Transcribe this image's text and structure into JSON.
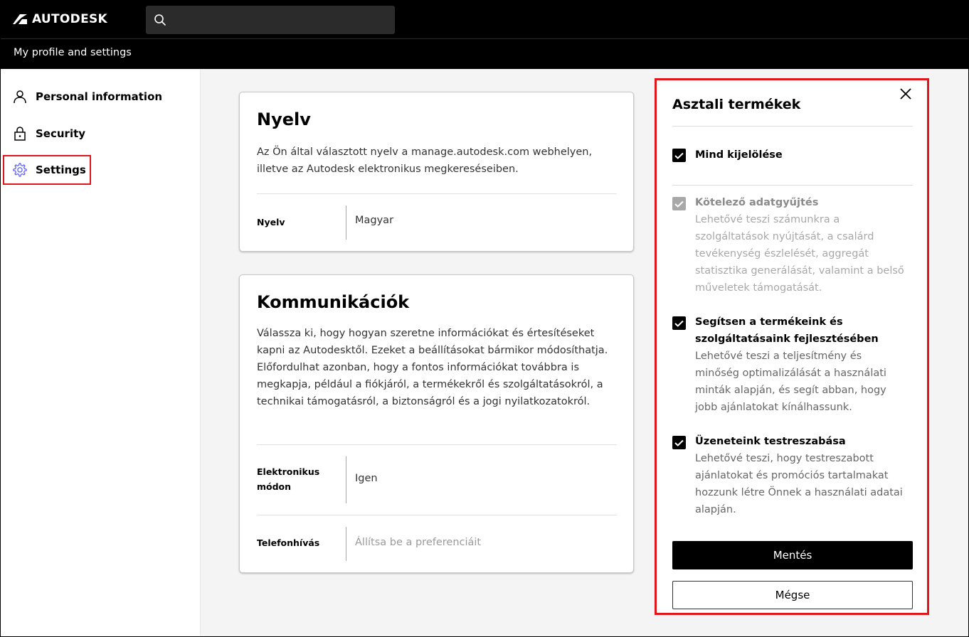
{
  "header": {
    "brand": "AUTODESK",
    "search_placeholder": "",
    "subtitle": "My profile and settings"
  },
  "sidebar": {
    "items": [
      {
        "label": "Personal information",
        "icon": "person-icon",
        "active": false
      },
      {
        "label": "Security",
        "icon": "lock-icon",
        "active": false
      },
      {
        "label": "Settings",
        "icon": "gear-icon",
        "active": true
      }
    ]
  },
  "language_card": {
    "title": "Nyelv",
    "description": "Az Ön által választott nyelv a manage.autodesk.com webhelyen, illetve az Autodesk elektronikus megkereséseiben.",
    "rows": [
      {
        "label": "Nyelv",
        "value": "Magyar"
      }
    ]
  },
  "communications_card": {
    "title": "Kommunikációk",
    "description": "Válassza ki, hogy hogyan szeretne információkat és értesítéseket kapni az Autodesktől. Ezeket a beállításokat bármikor módosíthatja. Előfordulhat azonban, hogy a fontos információkat továbbra is megkapja, például a fiókjáról, a termékekről és szolgáltatásokról, a technikai támogatásról, a biztonságról és a jogi nyilatkozatokról.",
    "rows": [
      {
        "label": "Elektronikus módon",
        "value": "Igen"
      },
      {
        "label": "Telefonhívás",
        "value": "Állítsa be a preferenciáit"
      }
    ]
  },
  "panel": {
    "title": "Asztali termékek",
    "select_all": {
      "label": "Mind kijelölése",
      "checked": true
    },
    "options": [
      {
        "label": "Kötelező adatgyűjtés",
        "description": "Lehetővé teszi számunkra a szolgáltatások nyújtását, a csalárd tevékenység észlelését, aggregát statisztika generálását, valamint a belső műveletek támogatását.",
        "checked": true,
        "disabled": true
      },
      {
        "label": "Segítsen a termékeink és szolgáltatásaink fejlesztésében",
        "description": "Lehetővé teszi a teljesítmény és minőség optimalizálását a használati minták alapján, és segít abban, hogy jobb ajánlatokat kínálhassunk.",
        "checked": true,
        "disabled": false
      },
      {
        "label": "Üzeneteink testreszabása",
        "description": "Lehetővé teszi, hogy testreszabott ajánlatokat és promóciós tartalmakat hozzunk létre Önnek a használati adatai alapján.",
        "checked": true,
        "disabled": false
      }
    ],
    "save_label": "Mentés",
    "cancel_label": "Mégse"
  },
  "colors": {
    "highlight": "#e0161b",
    "accent_icon": "#5f60ff",
    "header_bg": "#000000"
  }
}
